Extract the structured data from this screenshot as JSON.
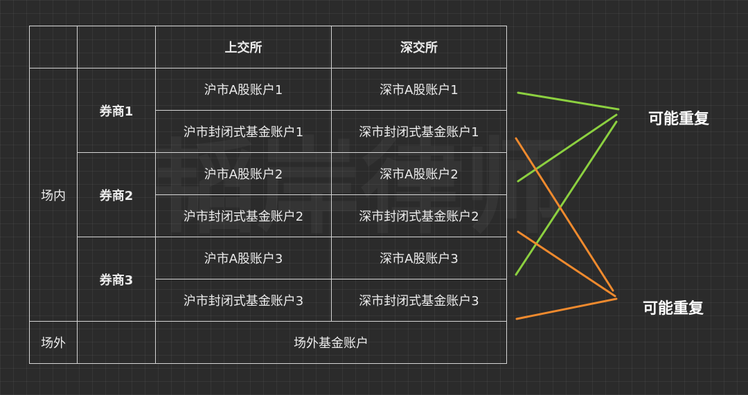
{
  "header": {
    "shanghai": "上交所",
    "shenzhen": "深交所"
  },
  "zones": {
    "on_exchange": "场内",
    "off_exchange": "场外"
  },
  "brokers": [
    {
      "name": "券商1",
      "rows": [
        {
          "shanghai": "沪市A股账户1",
          "shenzhen": "深市A股账户1"
        },
        {
          "shanghai": "沪市封闭式基金账户1",
          "shenzhen": "深市封闭式基金账户1"
        }
      ]
    },
    {
      "name": "券商2",
      "rows": [
        {
          "shanghai": "沪市A股账户2",
          "shenzhen": "深市A股账户2"
        },
        {
          "shanghai": "沪市封闭式基金账户2",
          "shenzhen": "深市封闭式基金账户2"
        }
      ]
    },
    {
      "name": "券商3",
      "rows": [
        {
          "shanghai": "沪市A股账户3",
          "shenzhen": "深市A股账户3"
        },
        {
          "shanghai": "沪市封闭式基金账户3",
          "shenzhen": "深市封闭式基金账户3"
        }
      ]
    }
  ],
  "off_exchange_account": "场外基金账户",
  "annotations": {
    "top": "可能重复",
    "bottom": "可能重复"
  },
  "colors": {
    "shenzhen_a_share_links": "#8cd040",
    "shenzhen_fund_links": "#ef8a2e",
    "header_text": "#ef8a2e",
    "broker_text": "#8cd040",
    "background": "#2b2b2b"
  }
}
